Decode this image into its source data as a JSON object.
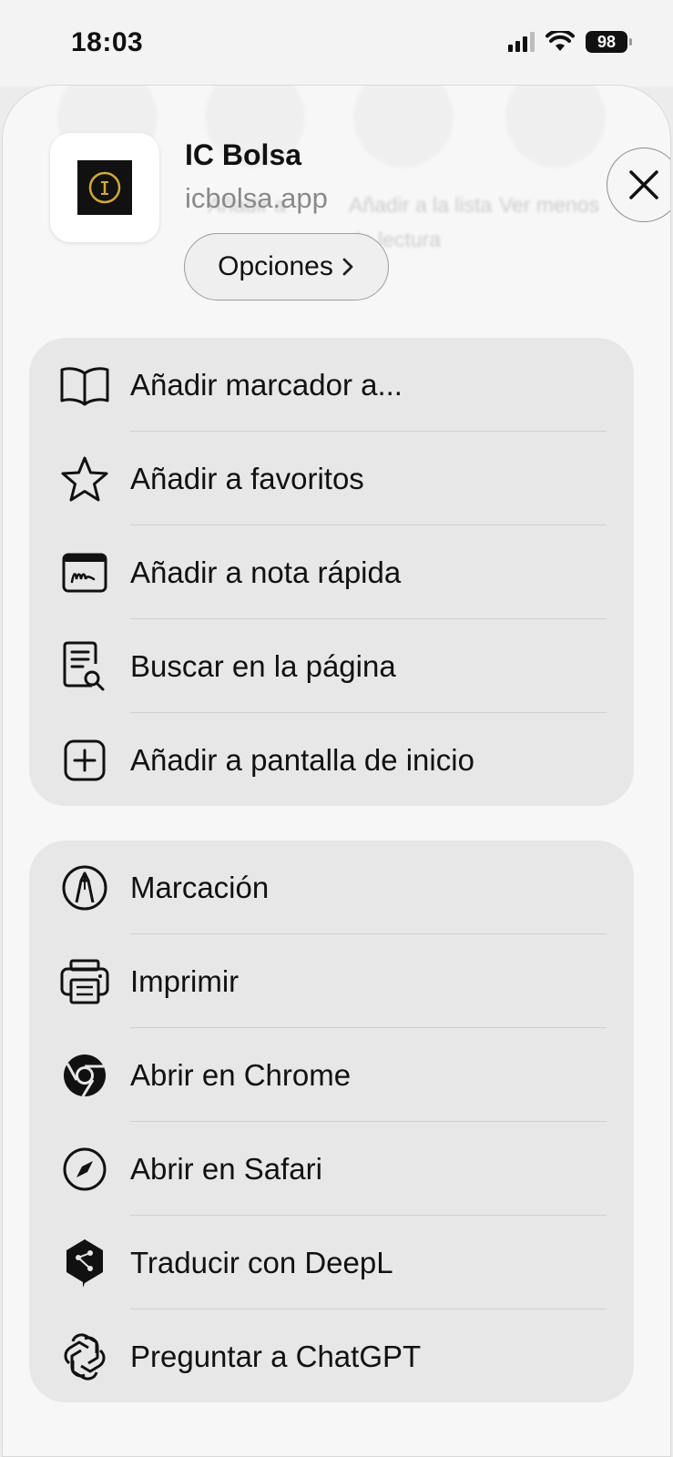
{
  "status_bar": {
    "time": "18:03",
    "battery": "98"
  },
  "background_actions": [
    {
      "label": "Añadir a"
    },
    {
      "label": "Añadir a la lista de lectura"
    },
    {
      "label": "Ver menos"
    }
  ],
  "header": {
    "app_name": "IC Bolsa",
    "domain": "icbolsa.app",
    "options_label": "Opciones"
  },
  "group1": [
    {
      "label": "Añadir marcador a...",
      "icon": "book-icon"
    },
    {
      "label": "Añadir a favoritos",
      "icon": "star-icon"
    },
    {
      "label": "Añadir a nota rápida",
      "icon": "quick-note-icon"
    },
    {
      "label": "Buscar en la página",
      "icon": "find-in-page-icon"
    },
    {
      "label": "Añadir a pantalla de inicio",
      "icon": "add-square-icon"
    }
  ],
  "group2": [
    {
      "label": "Marcación",
      "icon": "markup-icon"
    },
    {
      "label": "Imprimir",
      "icon": "printer-icon"
    },
    {
      "label": "Abrir en Chrome",
      "icon": "chrome-icon"
    },
    {
      "label": "Abrir en Safari",
      "icon": "compass-icon"
    },
    {
      "label": "Traducir con DeepL",
      "icon": "deepl-icon"
    },
    {
      "label": "Preguntar a ChatGPT",
      "icon": "chatgpt-icon"
    }
  ]
}
